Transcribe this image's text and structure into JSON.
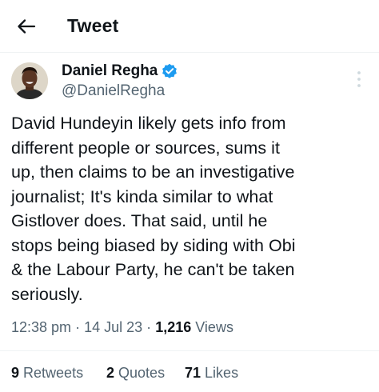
{
  "header": {
    "title": "Tweet",
    "back_icon": "arrow-left-icon"
  },
  "author": {
    "display_name": "Daniel Regha",
    "handle": "@DanielRegha",
    "verified_icon": "verified-badge-icon",
    "verified_color": "#1d9bf0"
  },
  "tweet": {
    "lines": [
      "David Hundeyin likely gets info from",
      "different people or sources, sums it",
      "up, then claims to be an investigative",
      "journalist; It's kinda similar to what",
      "Gistlover does. That said, until he",
      "stops being biased by siding with Obi",
      "& the Labour Party, he can't be taken",
      "seriously."
    ]
  },
  "meta": {
    "time": "12:38 pm",
    "sep1": "·",
    "date": "14 Jul 23",
    "sep2": "·",
    "views_count": "1,216",
    "views_label": "Views"
  },
  "stats": {
    "retweets_count": "9",
    "retweets_label": "Retweets",
    "quotes_count": "2",
    "quotes_label": "Quotes",
    "likes_count": "71",
    "likes_label": "Likes"
  },
  "colors": {
    "text": "#0f1419",
    "secondary": "#536471",
    "divider": "#eff3f4"
  }
}
